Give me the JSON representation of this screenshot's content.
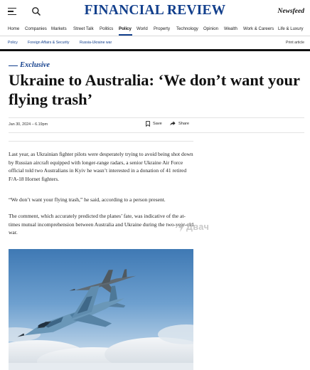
{
  "header": {
    "logo": "FINANCIAL REVIEW",
    "newsfeed_label": "Newsfeed"
  },
  "nav": {
    "items": [
      "Home",
      "Companies",
      "Markets",
      "Street Talk",
      "Politics",
      "Policy",
      "World",
      "Property",
      "Technology",
      "Opinion",
      "Wealth",
      "Work & Careers",
      "Life & Luxury"
    ],
    "active": "Policy"
  },
  "subnav": {
    "items": [
      "Policy",
      "Foreign Affairs & Security",
      "Russia-Ukraine war"
    ],
    "print_label": "Print article"
  },
  "article": {
    "kicker": "Exclusive",
    "headline": "Ukraine to Australia: ‘We don’t want your flying trash’",
    "date": "Jan 30, 2024 – 6.19pm",
    "save_label": "Save",
    "share_label": "Share",
    "paragraphs": [
      "Last year, as Ukrainian fighter pilots were desperately trying to avoid being shot down by Russian aircraft equipped with longer-range radars, a senior Ukraine Air Force official told two Australians in Kyiv he wasn’t interested in a donation of 41 retired F/A-18 Hornet fighters.",
      "“We don’t want your flying trash,” he said, according to a person present.",
      "The comment, which accurately predicted the planes’ fate, was indicative of the at-times mutual incomprehension between Australia and Ukraine during the two-year-old war."
    ]
  },
  "watermark": "Двач",
  "colors": {
    "brand": "#123f8c",
    "text": "#111111",
    "sky": "#5f95c6"
  },
  "icons": {
    "menu": "hamburger-icon",
    "search": "search-icon",
    "save": "bookmark-icon",
    "share": "share-arrow-icon",
    "watermark": "lightning-icon"
  }
}
